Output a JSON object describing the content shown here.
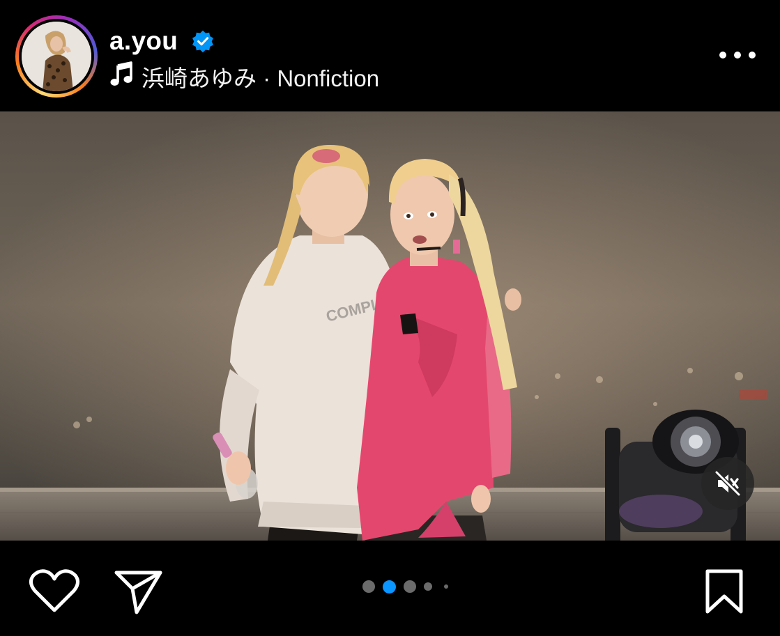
{
  "post": {
    "username": "a.you",
    "verified": true,
    "music": "浜崎あゆみ · Nonfiction"
  },
  "photo": {
    "hoodie_text": "COMPLETE"
  },
  "carousel": {
    "total": 5,
    "active_index": 1
  },
  "icons": {
    "verified": "verified-badge-icon",
    "music": "music-note-icon",
    "more": "more-options-icon",
    "mute": "speaker-muted-icon",
    "like": "heart-icon",
    "share": "send-icon",
    "save": "bookmark-icon"
  },
  "colors": {
    "background": "#000000",
    "verified_blue": "#0095f6",
    "active_dot": "#0a95ff",
    "inactive_dot": "#6b6b6b",
    "text": "#ffffff"
  }
}
